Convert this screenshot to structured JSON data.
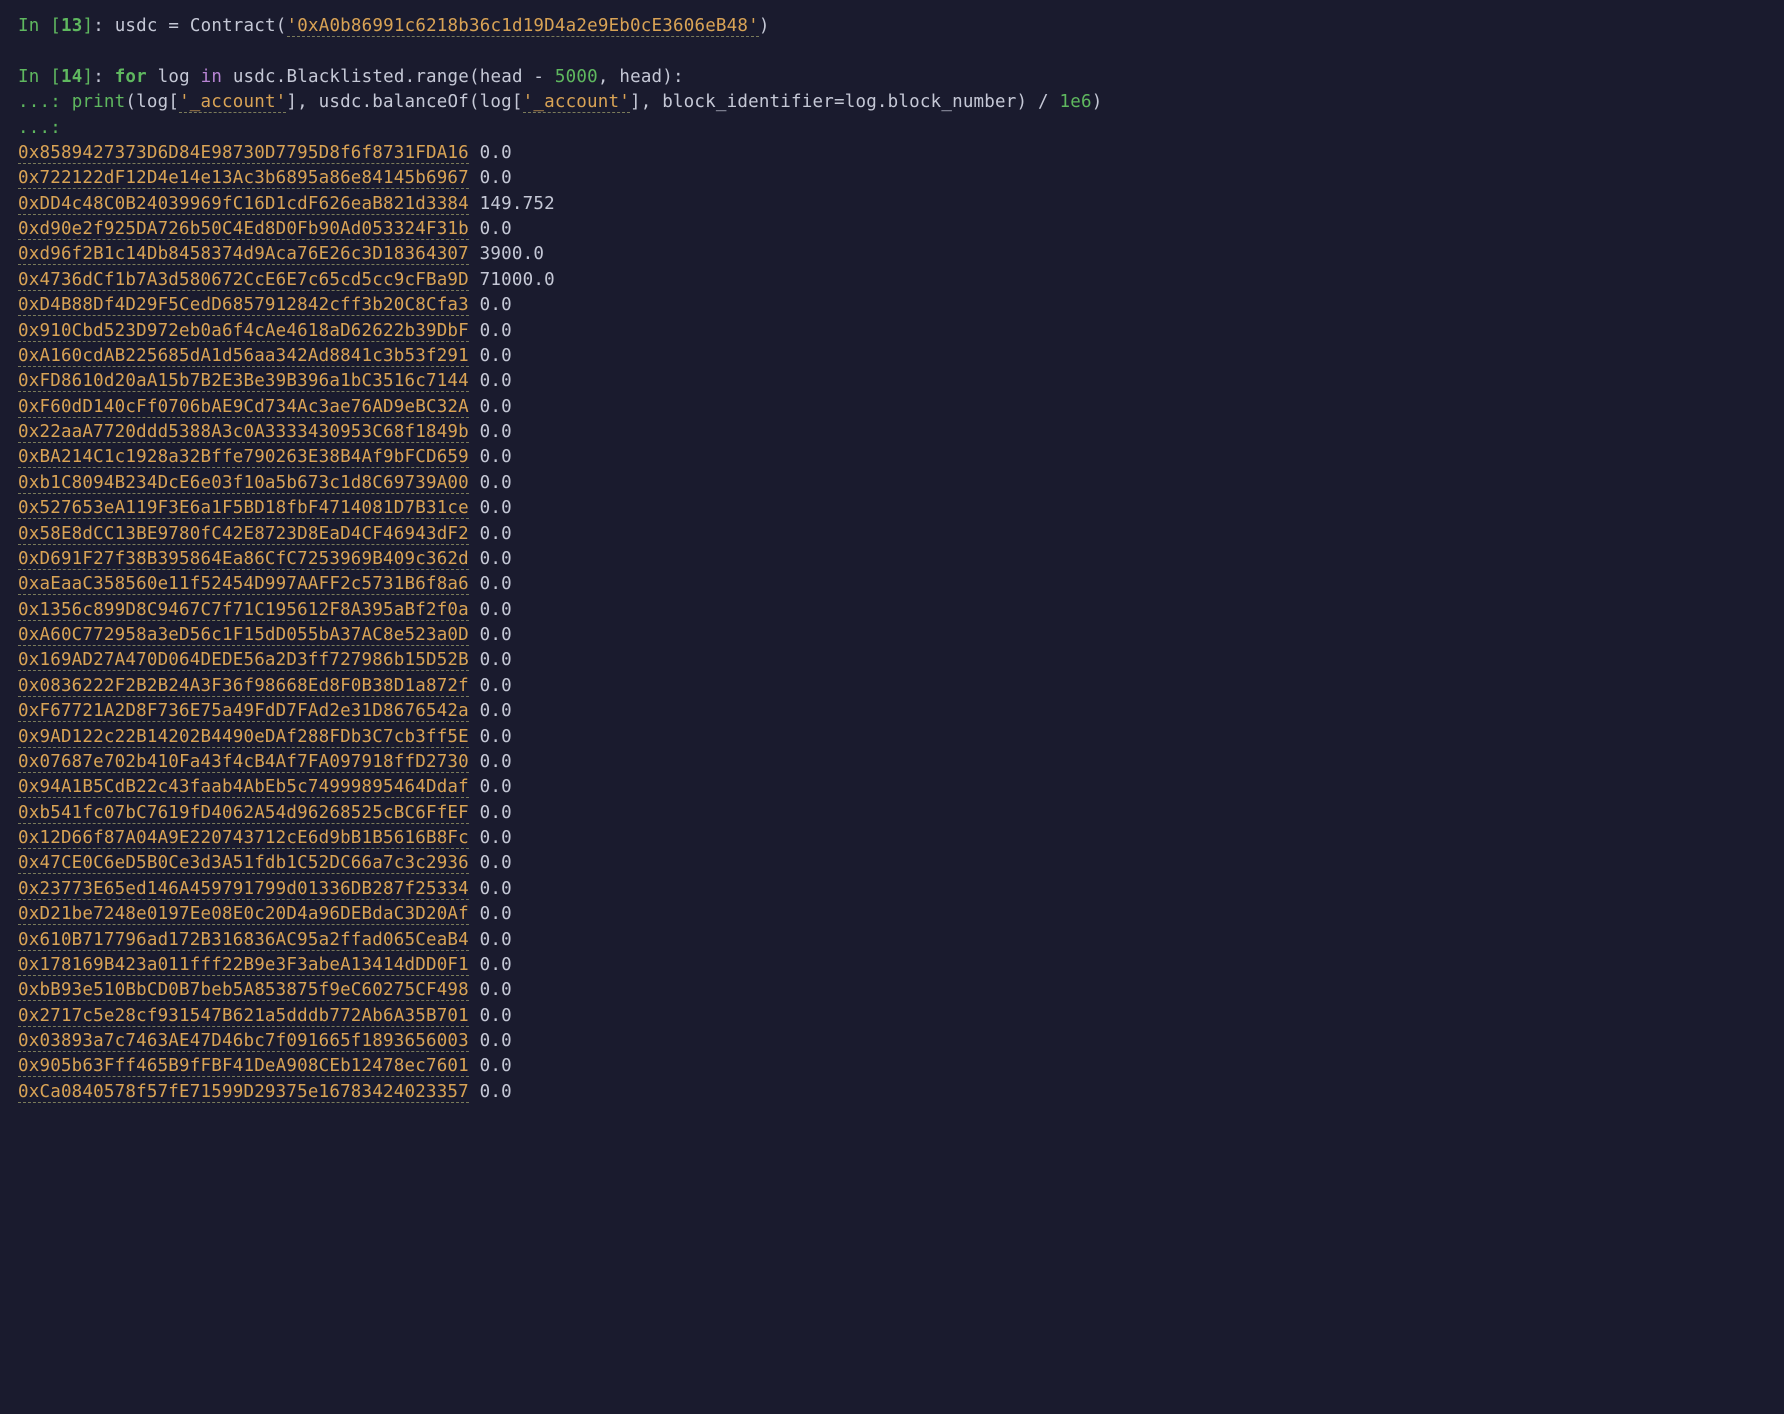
{
  "cell13": {
    "prompt_in": "In ",
    "prompt_num": "13",
    "open_br": "[",
    "close_br": "]",
    "colon_sp": ": ",
    "var": "usdc ",
    "eq": "= ",
    "func": "Contract",
    "lparen": "(",
    "addr_str": "'0xA0b86991c6218b36c1d19D4a2e9Eb0cE3606eB48'",
    "rparen": ")"
  },
  "cell14": {
    "prompt_in": "In ",
    "prompt_num": "14",
    "open_br": "[",
    "close_br": "]",
    "colon_sp": ": ",
    "kw_for": "for",
    "sp1": " log ",
    "kw_in": "in",
    "rest1": " usdc.Blacklisted.range(head ",
    "minus": "-",
    "sp2": " ",
    "num5000": "5000",
    "rest2": ", head):",
    "cont1": "    ...: ",
    "indent": "    ",
    "print": "print",
    "lparen2": "(log[",
    "str_acct1": "'_account'",
    "mid": "], usdc.balanceOf(log[",
    "str_acct2": "'_account'",
    "mid2": "], block_identifier",
    "eq2": "=",
    "mid3": "log.block_number) ",
    "div": "/",
    "sp3": " ",
    "e6": "1e6",
    "rparen2": ")",
    "cont2": "    ...: "
  },
  "output": [
    {
      "addr": "0x8589427373D6D84E98730D7795D8f6f8731FDA16",
      "bal": "0.0"
    },
    {
      "addr": "0x722122dF12D4e14e13Ac3b6895a86e84145b6967",
      "bal": "0.0"
    },
    {
      "addr": "0xDD4c48C0B24039969fC16D1cdF626eaB821d3384",
      "bal": "149.752"
    },
    {
      "addr": "0xd90e2f925DA726b50C4Ed8D0Fb90Ad053324F31b",
      "bal": "0.0"
    },
    {
      "addr": "0xd96f2B1c14Db8458374d9Aca76E26c3D18364307",
      "bal": "3900.0"
    },
    {
      "addr": "0x4736dCf1b7A3d580672CcE6E7c65cd5cc9cFBa9D",
      "bal": "71000.0"
    },
    {
      "addr": "0xD4B88Df4D29F5CedD6857912842cff3b20C8Cfa3",
      "bal": "0.0"
    },
    {
      "addr": "0x910Cbd523D972eb0a6f4cAe4618aD62622b39DbF",
      "bal": "0.0"
    },
    {
      "addr": "0xA160cdAB225685dA1d56aa342Ad8841c3b53f291",
      "bal": "0.0"
    },
    {
      "addr": "0xFD8610d20aA15b7B2E3Be39B396a1bC3516c7144",
      "bal": "0.0"
    },
    {
      "addr": "0xF60dD140cFf0706bAE9Cd734Ac3ae76AD9eBC32A",
      "bal": "0.0"
    },
    {
      "addr": "0x22aaA7720ddd5388A3c0A3333430953C68f1849b",
      "bal": "0.0"
    },
    {
      "addr": "0xBA214C1c1928a32Bffe790263E38B4Af9bFCD659",
      "bal": "0.0"
    },
    {
      "addr": "0xb1C8094B234DcE6e03f10a5b673c1d8C69739A00",
      "bal": "0.0"
    },
    {
      "addr": "0x527653eA119F3E6a1F5BD18fbF4714081D7B31ce",
      "bal": "0.0"
    },
    {
      "addr": "0x58E8dCC13BE9780fC42E8723D8EaD4CF46943dF2",
      "bal": "0.0"
    },
    {
      "addr": "0xD691F27f38B395864Ea86CfC7253969B409c362d",
      "bal": "0.0"
    },
    {
      "addr": "0xaEaaC358560e11f52454D997AAFF2c5731B6f8a6",
      "bal": "0.0"
    },
    {
      "addr": "0x1356c899D8C9467C7f71C195612F8A395aBf2f0a",
      "bal": "0.0"
    },
    {
      "addr": "0xA60C772958a3eD56c1F15dD055bA37AC8e523a0D",
      "bal": "0.0"
    },
    {
      "addr": "0x169AD27A470D064DEDE56a2D3ff727986b15D52B",
      "bal": "0.0"
    },
    {
      "addr": "0x0836222F2B2B24A3F36f98668Ed8F0B38D1a872f",
      "bal": "0.0"
    },
    {
      "addr": "0xF67721A2D8F736E75a49FdD7FAd2e31D8676542a",
      "bal": "0.0"
    },
    {
      "addr": "0x9AD122c22B14202B4490eDAf288FDb3C7cb3ff5E",
      "bal": "0.0"
    },
    {
      "addr": "0x07687e702b410Fa43f4cB4Af7FA097918ffD2730",
      "bal": "0.0"
    },
    {
      "addr": "0x94A1B5CdB22c43faab4AbEb5c74999895464Ddaf",
      "bal": "0.0"
    },
    {
      "addr": "0xb541fc07bC7619fD4062A54d96268525cBC6FfEF",
      "bal": "0.0"
    },
    {
      "addr": "0x12D66f87A04A9E220743712cE6d9bB1B5616B8Fc",
      "bal": "0.0"
    },
    {
      "addr": "0x47CE0C6eD5B0Ce3d3A51fdb1C52DC66a7c3c2936",
      "bal": "0.0"
    },
    {
      "addr": "0x23773E65ed146A459791799d01336DB287f25334",
      "bal": "0.0"
    },
    {
      "addr": "0xD21be7248e0197Ee08E0c20D4a96DEBdaC3D20Af",
      "bal": "0.0"
    },
    {
      "addr": "0x610B717796ad172B316836AC95a2ffad065CeaB4",
      "bal": "0.0"
    },
    {
      "addr": "0x178169B423a011fff22B9e3F3abeA13414dDD0F1",
      "bal": "0.0"
    },
    {
      "addr": "0xbB93e510BbCD0B7beb5A853875f9eC60275CF498",
      "bal": "0.0"
    },
    {
      "addr": "0x2717c5e28cf931547B621a5dddb772Ab6A35B701",
      "bal": "0.0"
    },
    {
      "addr": "0x03893a7c7463AE47D46bc7f091665f1893656003",
      "bal": "0.0"
    },
    {
      "addr": "0x905b63Fff465B9fFBF41DeA908CEb12478ec7601",
      "bal": "0.0"
    },
    {
      "addr": "0xCa0840578f57fE71599D29375e16783424023357",
      "bal": "0.0"
    }
  ]
}
